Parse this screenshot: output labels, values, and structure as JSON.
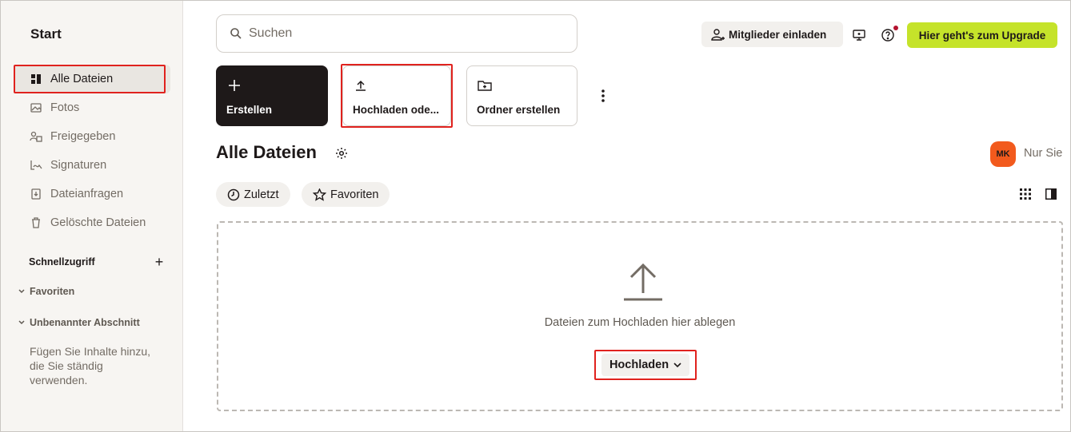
{
  "sidebar": {
    "start_label": "Start",
    "items": [
      {
        "label": "Alle Dateien",
        "icon": "files-icon"
      },
      {
        "label": "Fotos",
        "icon": "photo-icon"
      },
      {
        "label": "Freigegeben",
        "icon": "shared-icon"
      },
      {
        "label": "Signaturen",
        "icon": "signature-icon"
      },
      {
        "label": "Dateianfragen",
        "icon": "file-request-icon"
      },
      {
        "label": "Gelöschte Dateien",
        "icon": "trash-icon"
      }
    ],
    "quick_access_label": "Schnellzugriff",
    "favorites_label": "Favoriten",
    "unnamed_section_label": "Unbenannter Abschnitt",
    "hint": "Fügen Sie Inhalte hinzu, die Sie ständig verwenden."
  },
  "search": {
    "placeholder": "Suchen"
  },
  "header": {
    "invite_label": "Mitglieder einladen",
    "upgrade_label": "Hier geht's zum Upgrade"
  },
  "tiles": {
    "create_label": "Erstellen",
    "upload_label": "Hochladen ode...",
    "folder_label": "Ordner erstellen"
  },
  "page": {
    "title": "Alle Dateien",
    "avatar_initials": "MK",
    "share_label": "Nur Sie"
  },
  "filters": {
    "recent_label": "Zuletzt",
    "favorites_label": "Favoriten"
  },
  "dropzone": {
    "text": "Dateien zum Hochladen hier ablegen",
    "button_label": "Hochladen"
  },
  "colors": {
    "accent_lime": "#c5e32a",
    "highlight_red": "#e0221e",
    "avatar_orange": "#f25a1d",
    "dark_tile": "#1e1919"
  }
}
